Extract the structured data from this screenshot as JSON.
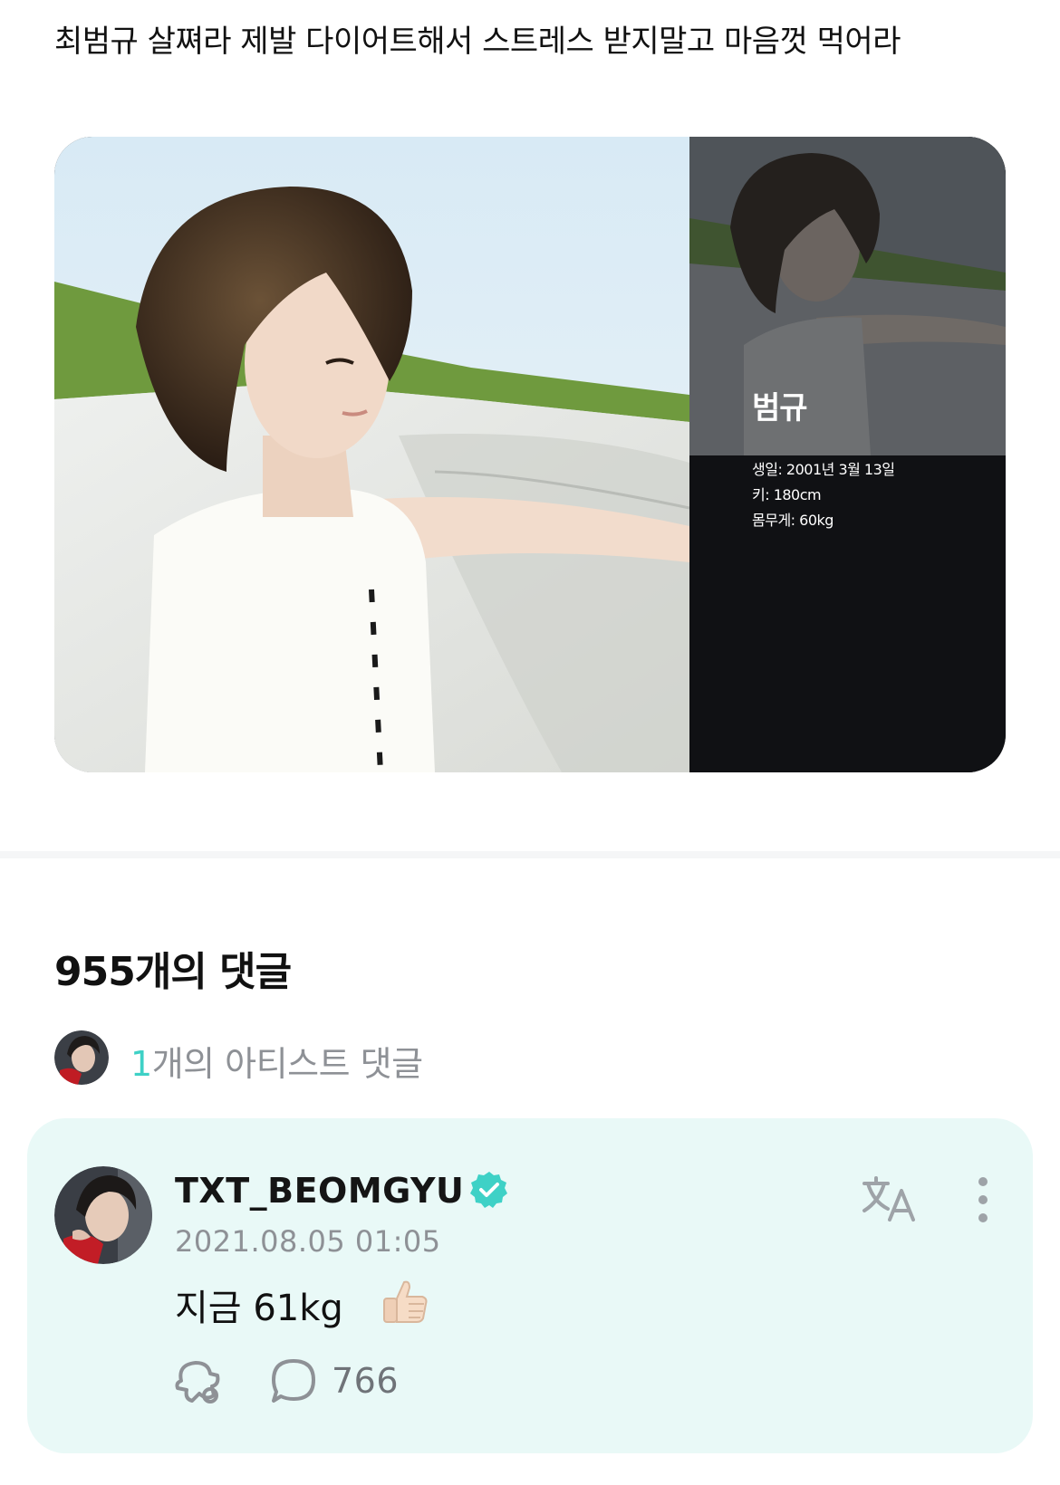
{
  "post": {
    "text": "최범규 살쪄라 제발 다이어트해서 스트레스 받지말고 마음껏 먹어라"
  },
  "profile_card": {
    "name": "범규",
    "birth": "생일: 2001년 3월 13일",
    "height": "키: 180cm",
    "weight": "몸무게: 60kg"
  },
  "comments": {
    "heading": "955개의 댓글",
    "artist_count": "1",
    "artist_label": "개의 아티스트 댓글"
  },
  "comment": {
    "author": "TXT_BEOMGYU",
    "date": "2021.08.05 01:05",
    "body": "지금 61kg",
    "reply_count": "766",
    "icons": [
      "verified-icon",
      "translate-icon",
      "more-icon",
      "like-icon",
      "reply-icon",
      "thumbs-up-emoji"
    ]
  },
  "colors": {
    "accent": "#3ed1c6",
    "card_bg": "#e9f9f7",
    "muted_text": "#8e9196"
  }
}
